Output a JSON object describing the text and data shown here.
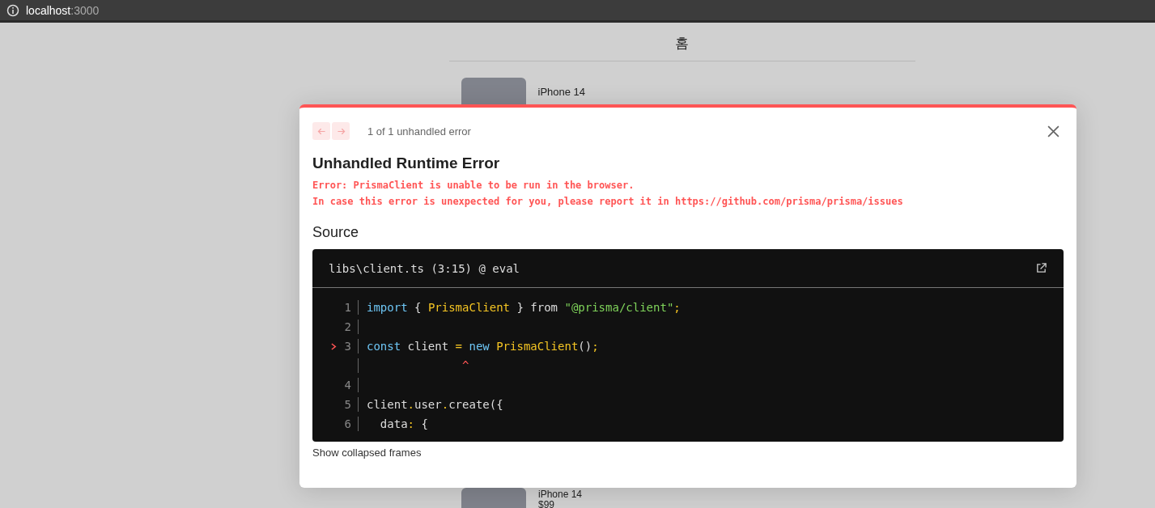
{
  "browser": {
    "url_host": "localhost",
    "url_port": ":3000"
  },
  "page": {
    "title": "홈",
    "products": [
      {
        "name": "iPhone 14"
      }
    ],
    "bottom_product": {
      "name": "iPhone 14",
      "price": "$99"
    }
  },
  "error_overlay": {
    "nav": [
      {
        "kind": "prev",
        "disabled": true
      },
      {
        "kind": "next",
        "disabled": true
      }
    ],
    "counter": "1 of 1 unhandled error",
    "title": "Unhandled Runtime Error",
    "messages": [
      "Error: PrismaClient is unable to be run in the browser.",
      "In case this error is unexpected for you, please report it in https://github.com/prisma/prisma/issues"
    ],
    "source_heading": "Source",
    "source": {
      "file": "libs\\client.ts (3:15) @ eval",
      "lines": [
        {
          "number": "1",
          "highlighted": false,
          "tokens": [
            {
              "kind": "keyword",
              "text": "import"
            },
            {
              "kind": "plain",
              "text": " { "
            },
            {
              "kind": "name",
              "text": "PrismaClient"
            },
            {
              "kind": "plain",
              "text": " } from "
            },
            {
              "kind": "string",
              "text": "\"@prisma/client\""
            },
            {
              "kind": "punct",
              "text": ";"
            }
          ]
        },
        {
          "number": "2",
          "highlighted": false
        },
        {
          "number": "3",
          "highlighted": true,
          "tokens": [
            {
              "kind": "keyword",
              "text": "const"
            },
            {
              "kind": "plain",
              "text": " client "
            },
            {
              "kind": "punct",
              "text": "="
            },
            {
              "kind": "keyword",
              "text": " new"
            },
            {
              "kind": "name",
              "text": " PrismaClient"
            },
            {
              "kind": "plain",
              "text": "()"
            },
            {
              "kind": "punct",
              "text": ";"
            }
          ]
        },
        {
          "highlighted": false,
          "tokens": [
            {
              "kind": "caret",
              "text": "              ^"
            }
          ]
        },
        {
          "number": "4",
          "highlighted": false
        },
        {
          "number": "5",
          "highlighted": false,
          "tokens": [
            {
              "kind": "plain",
              "text": "client"
            },
            {
              "kind": "punct",
              "text": "."
            },
            {
              "kind": "plain",
              "text": "user"
            },
            {
              "kind": "punct",
              "text": "."
            },
            {
              "kind": "plain",
              "text": "create({"
            }
          ]
        },
        {
          "number": "6",
          "highlighted": false,
          "tokens": [
            {
              "kind": "plain",
              "text": "  data"
            },
            {
              "kind": "punct",
              "text": ":"
            },
            {
              "kind": "plain",
              "text": " {"
            }
          ]
        }
      ]
    },
    "collapsed_link": "Show collapsed frames"
  }
}
